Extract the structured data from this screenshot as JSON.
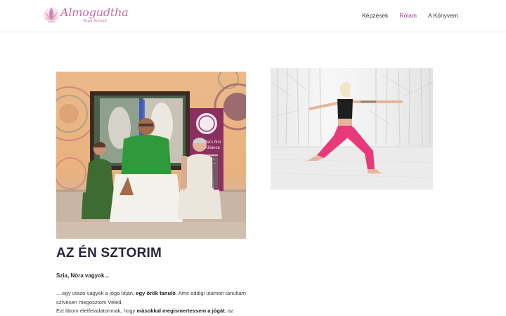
{
  "logo": {
    "title": "Almogudtha",
    "subtitle": "Yoga School"
  },
  "nav": {
    "items": [
      {
        "label": "Képzések",
        "active": false
      },
      {
        "label": "Rólam",
        "active": true
      },
      {
        "label": "A Könyvem",
        "active": false
      }
    ]
  },
  "photo1": {
    "banner_line1": "India's first",
    "banner_line2": "Yoga Alliance"
  },
  "story": {
    "heading": "AZ ÉN SZTORIM",
    "greeting": "Szia, Nóra vagyok...",
    "p1_a": "....egy utazó vagyok a jóga útján, ",
    "p1_b": "egy örök tanuló",
    "p1_c": ". Amit eddigi utamon tanultam szívesen megosztom Veled.",
    "p2_a": "Ezt látom életfeladatomnak, hogy ",
    "p2_b": "másokkal megismertessem a jógát",
    "p2_c": ", az"
  },
  "colors": {
    "accent": "#a23a91",
    "logo": "#c96a9e",
    "heading": "#27263a"
  }
}
